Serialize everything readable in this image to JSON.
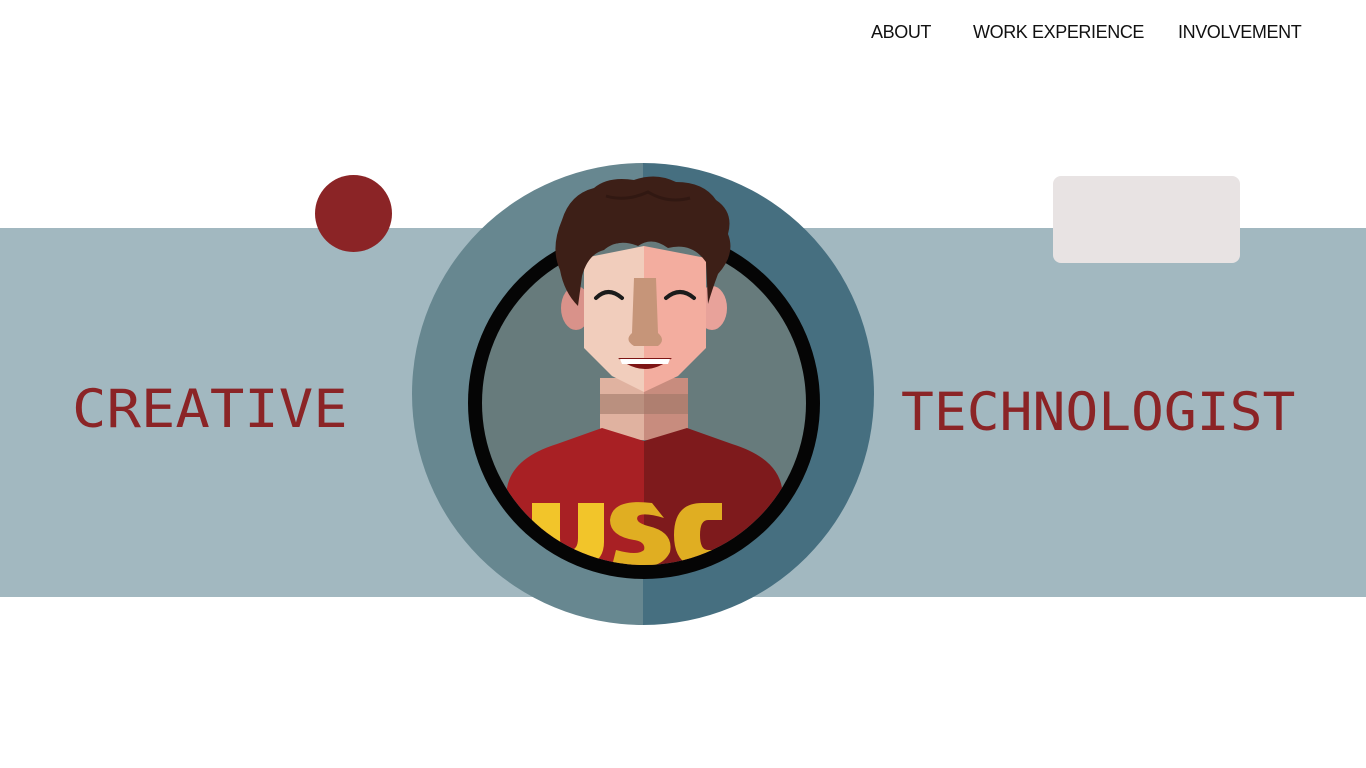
{
  "nav": {
    "items": [
      {
        "label": "ABOUT"
      },
      {
        "label": "WORK EXPERIENCE"
      },
      {
        "label": "INVOLVEMENT"
      }
    ]
  },
  "hero": {
    "left_word": "CREATIVE",
    "right_word": "TECHNOLOGIST",
    "shirt_text": "USC"
  },
  "colors": {
    "band": "#a2b8c0",
    "accent_red": "#8b2426",
    "card": "#e8e3e3",
    "ring_left": "#678790",
    "ring_right": "#466f80"
  }
}
